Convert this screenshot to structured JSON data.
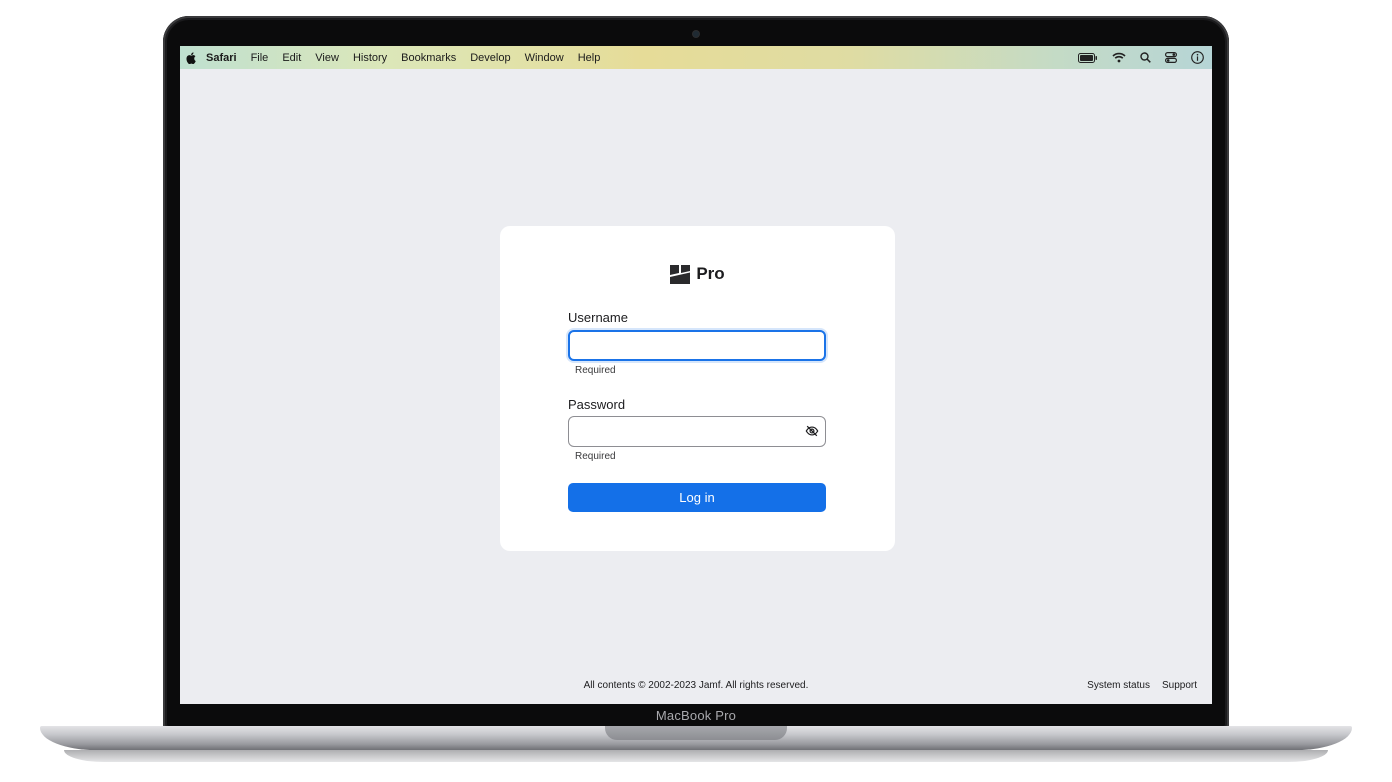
{
  "menubar": {
    "app": "Safari",
    "items": [
      "File",
      "Edit",
      "View",
      "History",
      "Bookmarks",
      "Develop",
      "Window",
      "Help"
    ]
  },
  "login": {
    "brand": "Pro",
    "username_label": "Username",
    "username_hint": "Required",
    "password_label": "Password",
    "password_hint": "Required",
    "submit_label": "Log in"
  },
  "footer": {
    "copyright": "All contents © 2002-2023 Jamf. All rights reserved.",
    "system_status": "System status",
    "support": "Support"
  },
  "device_label": "MacBook Pro",
  "colors": {
    "accent": "#1470e8",
    "page_background": "#ecedf1"
  },
  "icons": {
    "menubar_left": "apple-icon",
    "menubar_right": [
      "battery-icon",
      "wifi-icon",
      "search-icon",
      "control-center-icon",
      "info-icon"
    ],
    "password_field": "eye-slash-icon",
    "brand": "jamf-logo-icon"
  }
}
